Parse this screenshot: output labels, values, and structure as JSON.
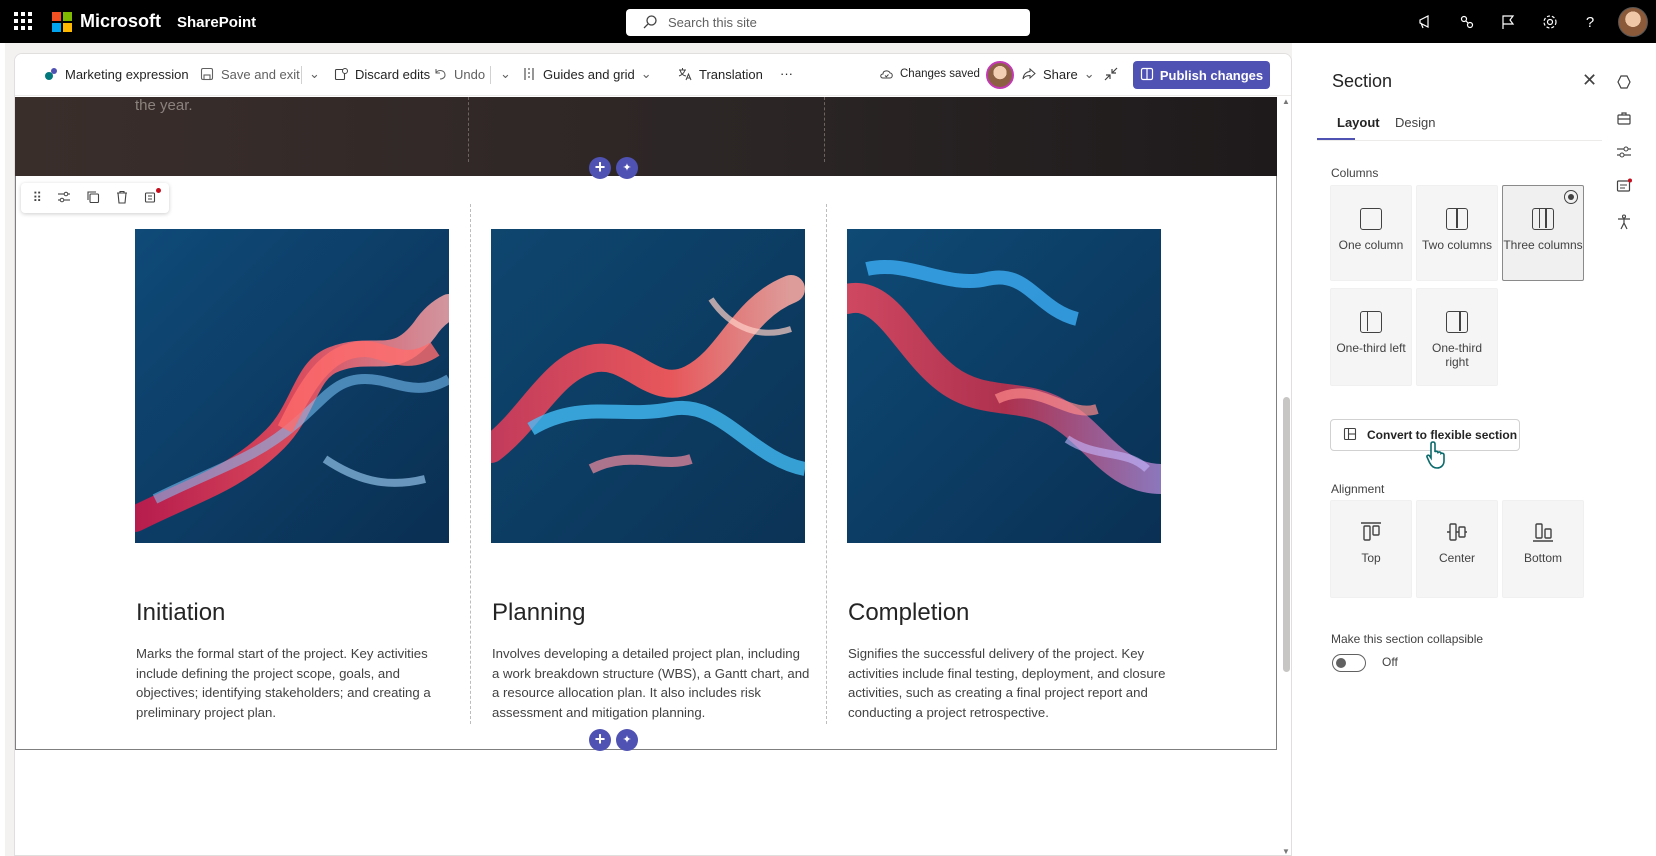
{
  "topbar": {
    "brand": "Microsoft",
    "app": "SharePoint",
    "search_placeholder": "Search this site",
    "icons": [
      "megaphone-icon",
      "share-network-icon",
      "flag-icon",
      "gear-icon",
      "help-icon",
      "avatar"
    ]
  },
  "toolbar": {
    "site_name": "Marketing expression",
    "save_exit": "Save and exit",
    "discard": "Discard edits",
    "undo": "Undo",
    "guides": "Guides and grid",
    "translation": "Translation",
    "more": "···",
    "status": "Changes saved",
    "share": "Share",
    "publish": "Publish changes"
  },
  "page": {
    "faded_text": "the year.",
    "columns": [
      {
        "title": "Initiation",
        "body": "Marks the formal start of the project. Key activities include defining the project scope, goals, and objectives; identifying stakeholders; and creating a preliminary project plan."
      },
      {
        "title": "Planning",
        "body": "Involves developing a detailed project plan, including a work breakdown structure (WBS), a Gantt chart, and a resource allocation plan. It also includes risk assessment and mitigation planning."
      },
      {
        "title": "Completion",
        "body": "Signifies the successful delivery of the project. Key activities include final testing, deployment, and closure activities, such as creating a final project report and conducting a project retrospective."
      }
    ]
  },
  "panel": {
    "title": "Section",
    "tabs": [
      "Layout",
      "Design"
    ],
    "active_tab": "Layout",
    "columns_label": "Columns",
    "column_options": [
      "One column",
      "Two columns",
      "Three columns",
      "One-third left",
      "One-third right"
    ],
    "selected_column": "Three columns",
    "convert_label": "Convert to flexible section",
    "alignment_label": "Alignment",
    "alignment_options": [
      "Top",
      "Center",
      "Bottom"
    ],
    "collapsible_label": "Make this section collapsible",
    "toggle_state": "Off"
  },
  "colors": {
    "accent": "#4f52b2",
    "topbar": "#000000",
    "image_bg": "#0f3c62"
  }
}
